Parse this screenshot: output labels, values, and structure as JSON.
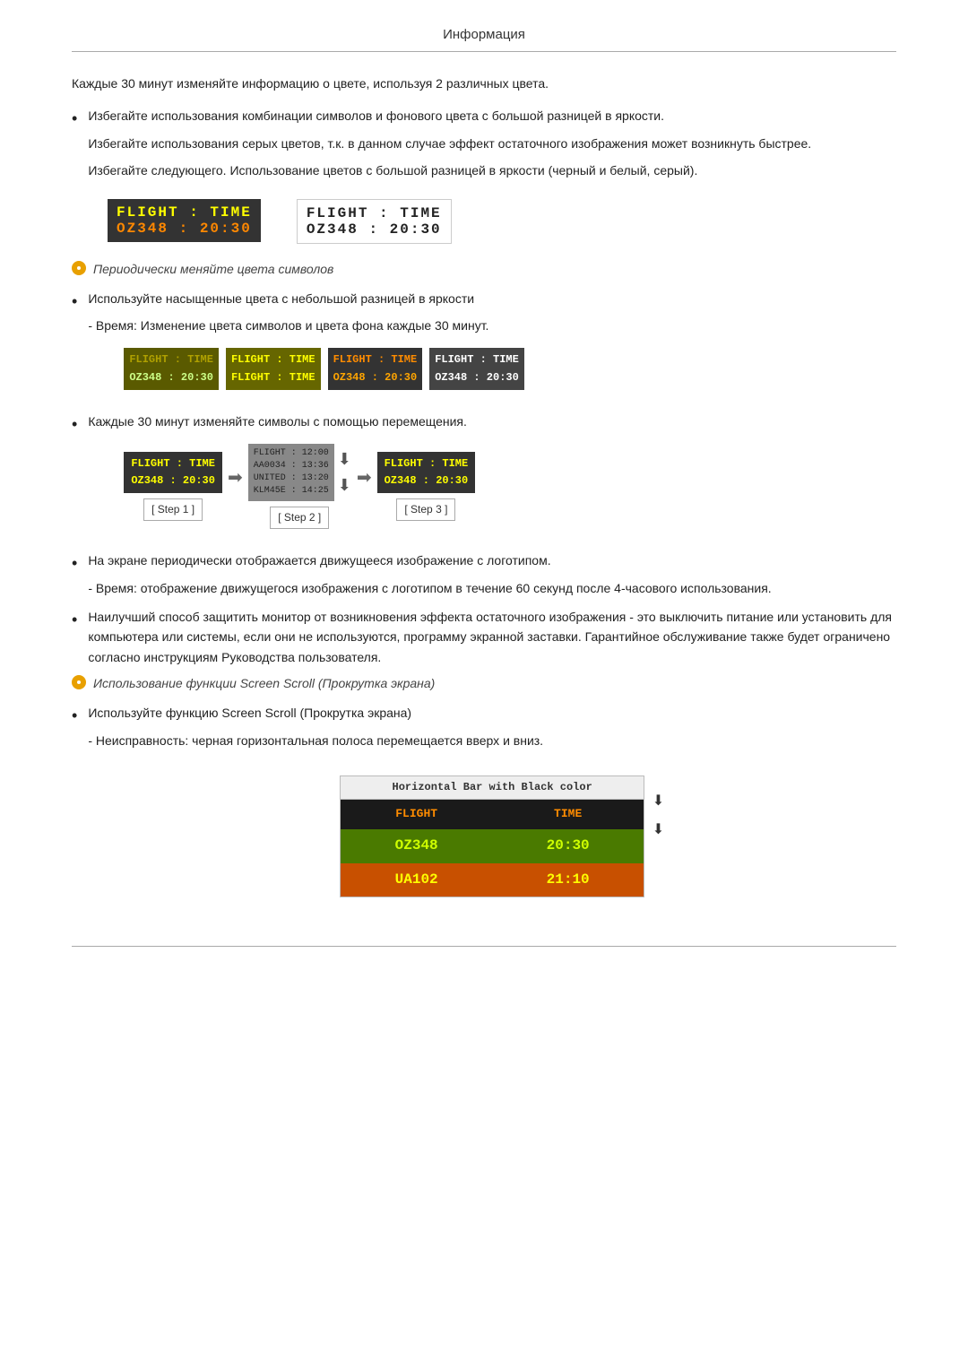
{
  "header": {
    "title": "Информация"
  },
  "intro": {
    "para1": "Каждые 30 минут изменяйте информацию о цвете, используя 2 различных цвета."
  },
  "bullets": [
    {
      "id": "b1",
      "text": "Избегайте использования комбинации символов и фонового цвета с большой разницей в яркости.",
      "sub1": "Избегайте использования серых цветов, т.к. в данном случае эффект остаточного изображения может возникнуть быстрее.",
      "sub2": "Избегайте следующего. Использование цветов с большой разницей в яркости (черный и белый, серый)."
    }
  ],
  "demo1": {
    "dark_row1": "FLIGHT  :  TIME",
    "dark_row2": "OZ348   :  20:30",
    "light_row1": "FLIGHT  :  TIME",
    "light_row2": "OZ348   :  20:30"
  },
  "section2": {
    "heading": "Периодически меняйте цвета символов",
    "bullet1": "Используйте насыщенные цвета с небольшой разницей в яркости",
    "sub1": "- Время: Изменение цвета символов и цвета фона каждые 30 минут."
  },
  "colorBoxes": [
    {
      "r1": "FLIGHT : TIME",
      "r2": "OZ348  : 20:30",
      "variant": "green"
    },
    {
      "r1": "FLIGHT : TIME",
      "r2": "FLIGHT : TIME",
      "variant": "yellow"
    },
    {
      "r1": "FLIGHT : TIME",
      "r2": "OZ348  : 20:30",
      "variant": "orange"
    },
    {
      "r1": "FLIGHT : TIME",
      "r2": "OZ348  : 20:30",
      "variant": "white"
    }
  ],
  "bullet3": {
    "text": "Каждые 30 минут изменяйте символы с помощью перемещения."
  },
  "steps": {
    "step1_label": "[ Step 1 ]",
    "step2_label": "[ Step 2 ]",
    "step3_label": "[ Step 3 ]",
    "step1_r1": "FLIGHT  :  TIME",
    "step1_r2": "OZ348   :  20:30",
    "step2_lines": [
      "FLIGHT : 12:00",
      "AA0034 : 13:36",
      "UNITED : 13:20",
      "KL M45E : 14:25"
    ],
    "step3_r1": "FLIGHT  :  TIME",
    "step3_r2": "OZ348   :  20:30"
  },
  "bullet4": {
    "text": "На экране периодически отображается движущееся изображение с логотипом.",
    "sub1": "- Время: отображение движущегося изображения с логотипом в течение 60 секунд после 4-часового использования."
  },
  "bullet5": {
    "text": "Наилучший способ защитить монитор от возникновения эффекта остаточного изображения - это выключить питание или установить для компьютера или системы, если они не используются, программу экранной заставки. Гарантийное обслуживание также будет ограничено согласно инструкциям Руководства пользователя."
  },
  "section3": {
    "heading": "Использование функции Screen Scroll (Прокрутка экрана)",
    "bullet1": "Используйте функцию Screen Scroll (Прокрутка экрана)",
    "sub1": "- Неисправность: черная горизонтальная полоса перемещается вверх и вниз."
  },
  "scrollDemo": {
    "header": "Horizontal Bar with Black color",
    "col1_header": "FLIGHT",
    "col2_header": "TIME",
    "row1_col1": "OZ348",
    "row1_col2": "20:30",
    "row2_col1": "UA102",
    "row2_col2": "21:10"
  }
}
